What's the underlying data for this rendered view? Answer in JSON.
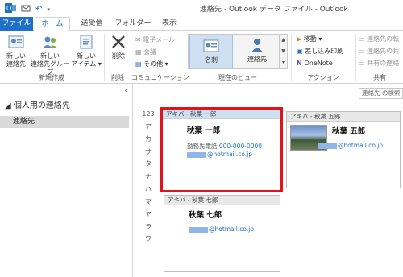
{
  "window": {
    "title": "連絡先 - Outlook データ ファイル - Outlook"
  },
  "tabs": [
    {
      "label": "ファイル"
    },
    {
      "label": "ホーム"
    },
    {
      "label": "送受信"
    },
    {
      "label": "フォルダー"
    },
    {
      "label": "表示"
    }
  ],
  "ribbon": {
    "new_group": {
      "label": "新規作成",
      "buttons": [
        {
          "label": "新しい\n連絡先"
        },
        {
          "label": "新しい\n連絡先グループ"
        },
        {
          "label": "新しい\nアイテム ▾"
        }
      ]
    },
    "delete_group": {
      "label": "削除",
      "button": "削除"
    },
    "comm_group": {
      "label": "コミュニケーション",
      "items": [
        "電子メール",
        "会議",
        "その他 ▾"
      ]
    },
    "view_group": {
      "label": "現在のビュー",
      "views": [
        "名刺",
        "連絡先"
      ]
    },
    "action_group": {
      "label": "アクション",
      "items": [
        "移動 ▾",
        "差し込み印刷",
        "OneNote"
      ]
    },
    "share_group": {
      "label": "共有",
      "items": [
        "連絡先の転",
        "連絡先の共",
        "共有の連絡"
      ]
    }
  },
  "nav": {
    "header": "個人用の連絡先",
    "selected_item": "連絡先"
  },
  "search": {
    "placeholder": "連絡先 の検索"
  },
  "index": [
    "123",
    "ア",
    "カ",
    "サ",
    "タ",
    "ナ",
    "ハ",
    "マ",
    "ヤ",
    "ラ",
    "ワ"
  ],
  "cards": [
    {
      "file_as": "アキバ - 秋葉 一郎",
      "name": "秋葉 一郎",
      "phone_label": "勤務先電話",
      "phone": "000-000-0000",
      "email_domain": "@hotmail.co.jp"
    },
    {
      "file_as": "アキバ - 秋葉 五郎",
      "name": "秋葉 五郎",
      "email_domain": "@hotmail.co.jp"
    },
    {
      "file_as": "アキバ - 秋葉 七郎",
      "name": "秋葉 七郎",
      "email_domain": "@hotmail.co.jp"
    }
  ],
  "colors": {
    "accent": "#1e6fc8",
    "selection_border": "#e0121a",
    "selected_header": "#cfe0f2"
  }
}
